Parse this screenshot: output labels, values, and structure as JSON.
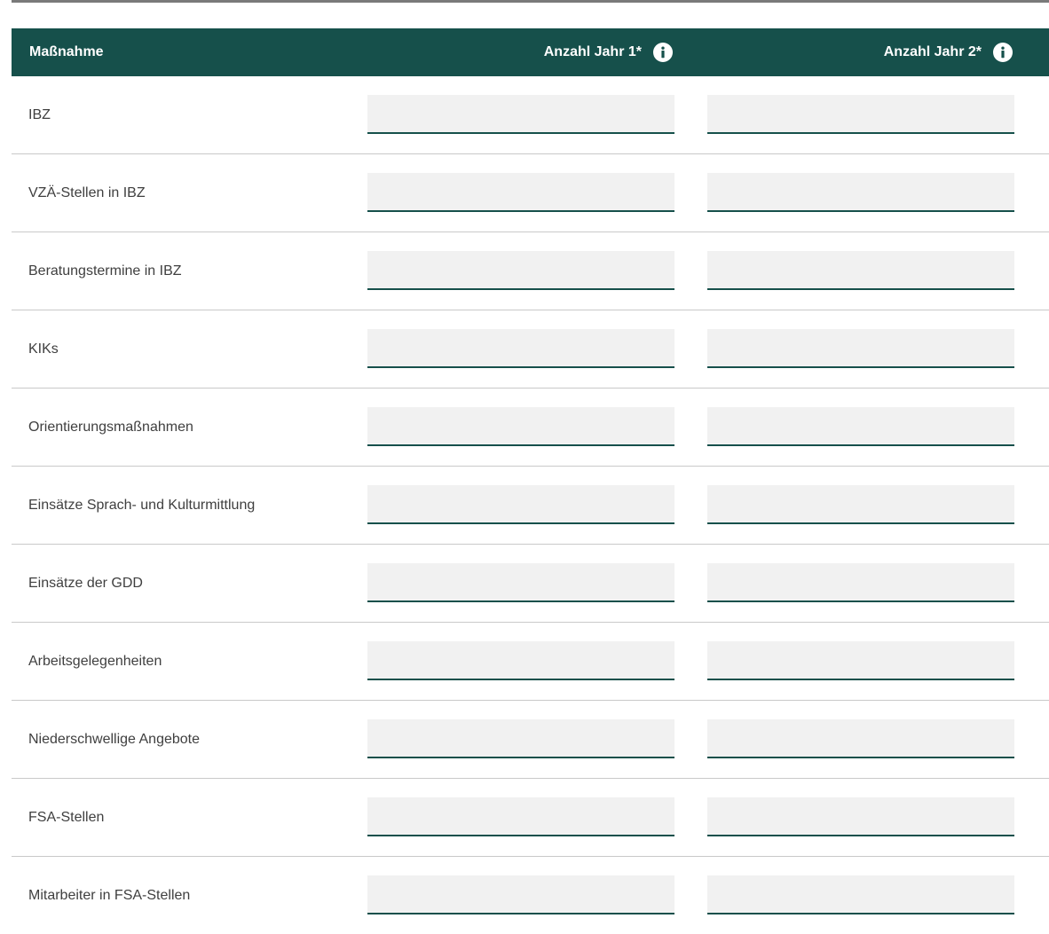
{
  "table": {
    "columns": [
      {
        "label": "Maßnahme",
        "info_icon": false
      },
      {
        "label": "Anzahl Jahr 1*",
        "info_icon": "info-icon"
      },
      {
        "label": "Anzahl Jahr 2*",
        "info_icon": "info-icon"
      }
    ],
    "rows": [
      {
        "label": "IBZ",
        "year1": "",
        "year2": ""
      },
      {
        "label": "VZÄ-Stellen in IBZ",
        "year1": "",
        "year2": ""
      },
      {
        "label": "Beratungstermine in IBZ",
        "year1": "",
        "year2": ""
      },
      {
        "label": "KIKs",
        "year1": "",
        "year2": ""
      },
      {
        "label": "Orientierungsmaßnahmen",
        "year1": "",
        "year2": ""
      },
      {
        "label": "Einsätze Sprach- und Kulturmittlung",
        "year1": "",
        "year2": ""
      },
      {
        "label": "Einsätze der GDD",
        "year1": "",
        "year2": ""
      },
      {
        "label": "Arbeitsgelegenheiten",
        "year1": "",
        "year2": ""
      },
      {
        "label": "Niederschwellige Angebote",
        "year1": "",
        "year2": ""
      },
      {
        "label": "FSA-Stellen",
        "year1": "",
        "year2": ""
      },
      {
        "label": "Mitarbeiter in FSA-Stellen",
        "year1": "",
        "year2": ""
      }
    ]
  },
  "colors": {
    "header_bg": "#16504b",
    "header_text": "#ffffff",
    "input_bg": "#f1f1f1",
    "input_underline": "#16504b",
    "row_divider": "#c9c9c9"
  }
}
